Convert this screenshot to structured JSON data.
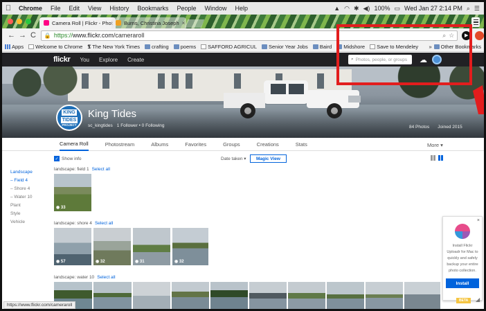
{
  "menubar": {
    "apple": "",
    "app": "Chrome",
    "items": [
      "File",
      "Edit",
      "View",
      "History",
      "Bookmarks",
      "People",
      "Window",
      "Help"
    ],
    "battery": "100%",
    "datetime": "Wed Jan 27  2:14 PM"
  },
  "tabs": [
    {
      "title": "Camera Roll | Flickr - Phot",
      "close": "×"
    },
    {
      "title": "Burns, Christina Joseph",
      "close": "×"
    }
  ],
  "omnibox": {
    "scheme": "https://",
    "host": "www.flickr.com",
    "path": "/cameraroll"
  },
  "ext1_label": "▶",
  "bookmarks": {
    "items": [
      "Apps",
      "Welcome to Chrome",
      "The New York Times",
      "crafting",
      "poems",
      "SAFFORD AGRICUL",
      "Senior Year Jobs",
      "Baird",
      "Midshore",
      "Save to Mendeley"
    ],
    "overflow": "»",
    "other": "Other Bookmarks"
  },
  "flickr": {
    "logo": "flickr",
    "nav": [
      "You",
      "Explore",
      "Create"
    ],
    "search_placeholder": "Photos, people, or groups"
  },
  "profile": {
    "avatar_lines": [
      "KING",
      "TIDES",
      "PROJECT"
    ],
    "name": "King Tides",
    "handle": "sc_kingtides",
    "followers": "1 Follower  •  0 Following",
    "photos": "84 Photos",
    "joined": "Joined 2015"
  },
  "subnav": {
    "tabs": [
      "Camera Roll",
      "Photostream",
      "Albums",
      "Favorites",
      "Groups",
      "Creations",
      "Stats"
    ],
    "more": "More ▾"
  },
  "leftnav": {
    "head": "Landscape",
    "items": [
      "– Field  4",
      "– Shore  4",
      "– Water  10",
      "Plant",
      "Style",
      "Vehicle"
    ]
  },
  "toolbar2": {
    "show_info": "Show info",
    "check": "✓",
    "date_taken": "Date taken  ▾",
    "magic_view": "Magic View"
  },
  "groups": [
    {
      "title": "landscape: field  1",
      "select": "Select all",
      "badges": [
        "33"
      ]
    },
    {
      "title": "landscape: shore  4",
      "select": "Select all",
      "badges": [
        "57",
        "32",
        "31",
        "32"
      ]
    },
    {
      "title": "landscape: water  10",
      "select": "Select all"
    }
  ],
  "install": {
    "close": "×",
    "text": "Install Flickr Uploadr for Mac to quickly and safely backup your entire photo collection.",
    "button": "Install",
    "beta": "BETA"
  },
  "status_url": "https://www.flickr.com/cameraroll",
  "colors": {
    "flickr_blue": "#0063dc",
    "annotation_red": "#e21d1d",
    "header_dark": "#212124"
  }
}
